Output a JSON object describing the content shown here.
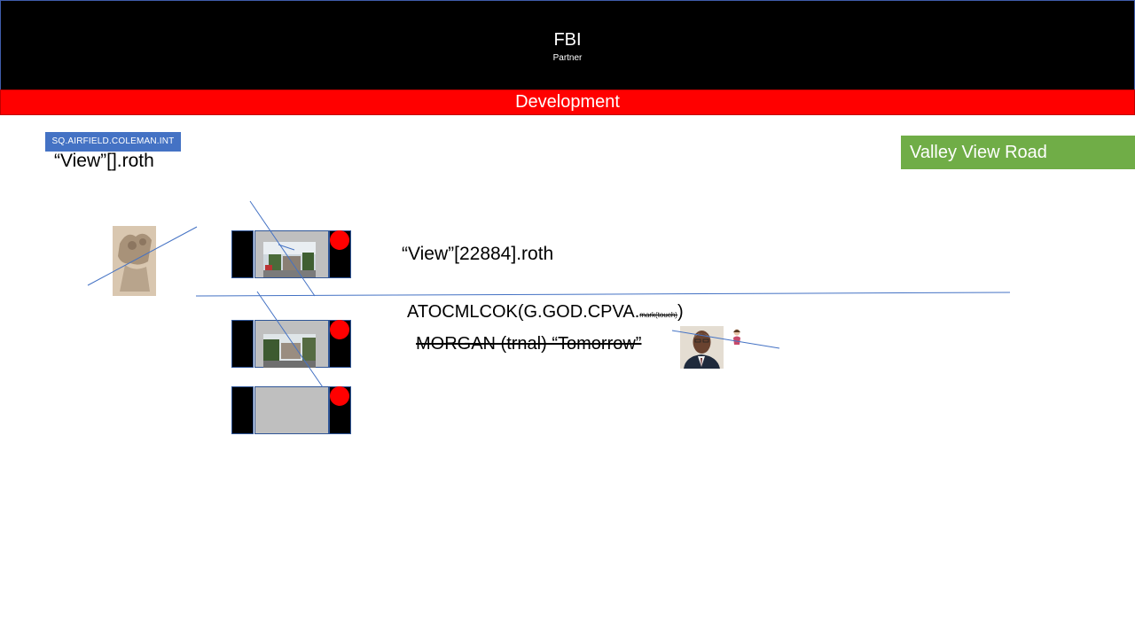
{
  "header": {
    "title": "FBI",
    "subtitle": "Partner"
  },
  "banner": {
    "label": "Development"
  },
  "tag": {
    "label": "SQ.AIRFIELD.COLEMAN.INT"
  },
  "left_label": {
    "text": "“View”[].roth"
  },
  "location_badge": {
    "label": "Valley View Road"
  },
  "main": {
    "view_label": "“View”[22884].roth",
    "code_text": "ATOCMLCOK(G.GOD.CPVA.",
    "code_small": "mark(touch)",
    "code_close": ")",
    "struck_text": "MORGAN (trnal) “Tomorrow”"
  },
  "colors": {
    "header_bg": "#000000",
    "banner_bg": "#ff0000",
    "tag_bg": "#4472c4",
    "badge_bg": "#70ad47",
    "panel_gray": "#bfbfbf",
    "dot_red": "#ff0000",
    "line_blue": "#4472c4"
  }
}
